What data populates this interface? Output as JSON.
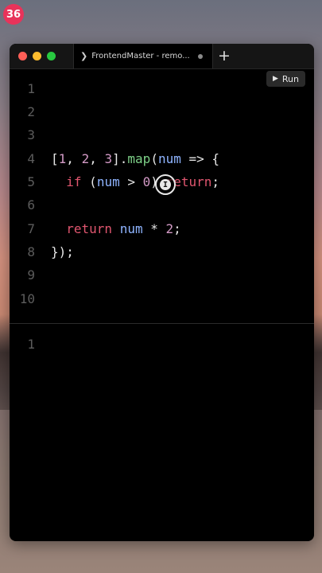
{
  "badge": {
    "text": "36"
  },
  "window": {
    "tab": {
      "label": "FrontendMaster - remo..."
    },
    "run_button": {
      "label": "Run"
    }
  },
  "editor": {
    "line_numbers": [
      "1",
      "2",
      "3",
      "4",
      "5",
      "6",
      "7",
      "8",
      "9",
      "10"
    ],
    "lines": [
      "",
      "",
      "",
      "[1, 2, 3].map(num => {",
      "  if (num > 0) return;",
      "",
      "  return num * 2;",
      "});",
      "",
      ""
    ]
  },
  "console": {
    "line_numbers": [
      "1"
    ]
  },
  "icons": {
    "cursor": "text-cursor-icon",
    "run": "play-icon",
    "tab": "chevron-right-icon",
    "add": "plus-icon"
  }
}
